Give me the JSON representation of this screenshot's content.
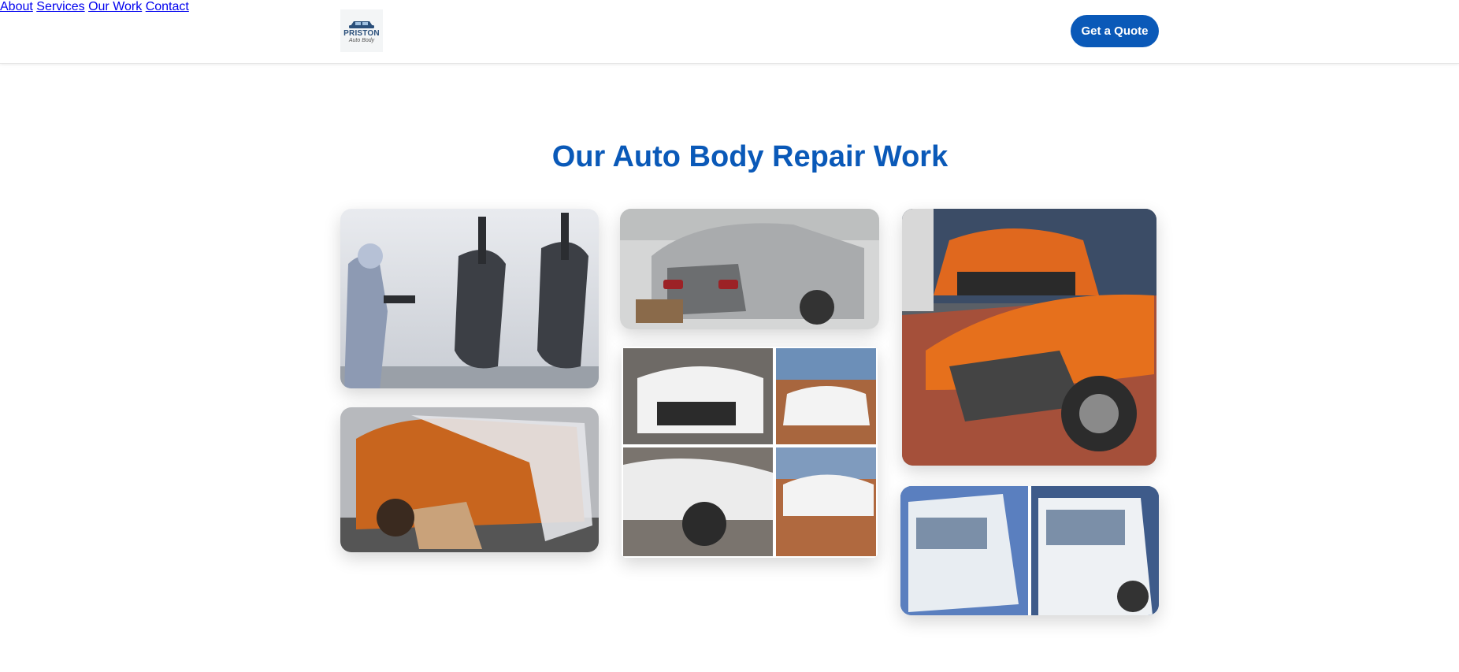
{
  "header": {
    "logo": {
      "word": "PRISTON",
      "sub": "Auto Body",
      "icon": "car-logo-icon"
    },
    "nav": [
      {
        "label": "About"
      },
      {
        "label": "Services"
      },
      {
        "label": "Our Work"
      },
      {
        "label": "Contact"
      }
    ],
    "cta_label": "Get a Quote",
    "brand_color": "#0a59b8"
  },
  "section": {
    "title": "Our Auto Body Repair Work"
  },
  "gallery": [
    {
      "id": "spray-painting-bumpers",
      "icon": "photo-icon"
    },
    {
      "id": "damaged-silver-hatchback",
      "icon": "photo-icon"
    },
    {
      "id": "renault-front-damage",
      "icon": "photo-icon"
    },
    {
      "id": "orange-pickup-masked",
      "icon": "photo-icon"
    },
    {
      "id": "ford-ranger-collage",
      "icon": "photo-icon"
    },
    {
      "id": "white-trucks",
      "icon": "photo-icon"
    }
  ]
}
